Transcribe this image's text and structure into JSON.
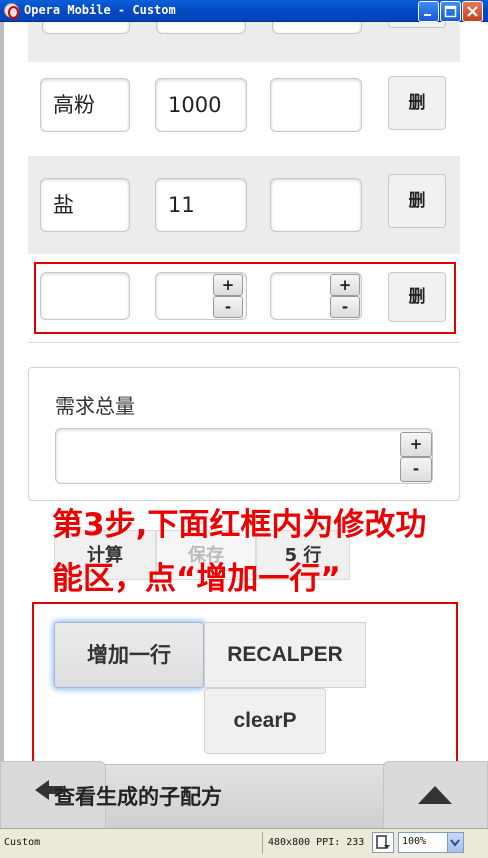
{
  "window": {
    "title": "Opera Mobile - Custom"
  },
  "ingredient_rows": [
    {
      "name": "高粉",
      "amount": "1000",
      "extra": "",
      "delete_label": "删"
    },
    {
      "name": "盐",
      "amount": "11",
      "extra": "",
      "delete_label": "删"
    },
    {
      "name": "",
      "amount": "",
      "extra": "",
      "delete_label": "删"
    }
  ],
  "spinner": {
    "plus": "+",
    "minus": "-"
  },
  "total": {
    "label": "需求总量",
    "value": ""
  },
  "tabs": {
    "calc": "计算",
    "save": "保存",
    "rows": "5 行"
  },
  "annotation": {
    "line1": "第3步,下面红框内为修改功",
    "line2": "能区，点“增加一行”"
  },
  "actions": {
    "add_row": "增加一行",
    "recalper": "RECALPER",
    "clearp": "clearP"
  },
  "footer": {
    "view_label": "查看生成的子配方"
  },
  "statusbar": {
    "name": "Custom",
    "resolution": "480x800 PPI: 233",
    "zoom": "100%"
  },
  "colors": {
    "annotation_red": "#ee0000",
    "titlebar_blue": "#0549c4",
    "focus_glow": "#9cc4ee"
  }
}
